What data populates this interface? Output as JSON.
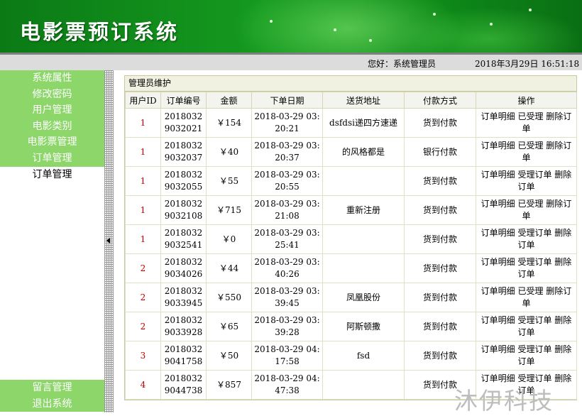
{
  "header": {
    "title": "电影票预订系统"
  },
  "infobar": {
    "greeting": "您好：系统管理员",
    "datetime": "2018年3月29日 16:51:18"
  },
  "sidebar": {
    "items": [
      "系统属性",
      "修改密码",
      "用户管理",
      "电影类别",
      "电影票管理",
      "订单管理"
    ],
    "active_sub": "订单管理",
    "bottom_items": [
      "留言管理",
      "退出系统"
    ]
  },
  "panel": {
    "title": "管理员维护"
  },
  "table": {
    "headers": [
      "用户ID",
      "订单编号",
      "金额",
      "下单日期",
      "送货地址",
      "付款方式",
      "操作"
    ],
    "rows": [
      {
        "uid": "1",
        "order": "20180329032021",
        "amount": "￥154",
        "date": "2018-03-29 03:20:21",
        "address": "dsfdsi递四方速递",
        "pay": "货到付款",
        "ops": "订单明细 已受理 删除订单"
      },
      {
        "uid": "1",
        "order": "20180329032037",
        "amount": "￥40",
        "date": "2018-03-29 03:20:37",
        "address": "的风格都是",
        "pay": "银行付款",
        "ops": "订单明细 已受理 删除订单"
      },
      {
        "uid": "1",
        "order": "20180329032055",
        "amount": "￥55",
        "date": "2018-03-29 03:20:55",
        "address": "",
        "pay": "货到付款",
        "ops": "订单明细 受理订单 删除订单"
      },
      {
        "uid": "1",
        "order": "20180329032108",
        "amount": "￥715",
        "date": "2018-03-29 03:21:08",
        "address": "重新注册",
        "pay": "货到付款",
        "ops": "订单明细 已受理 删除订单"
      },
      {
        "uid": "1",
        "order": "20180329032541",
        "amount": "￥0",
        "date": "2018-03-29 03:25:41",
        "address": "",
        "pay": "货到付款",
        "ops": "订单明细 受理订单 删除订单"
      },
      {
        "uid": "2",
        "order": "20180329034026",
        "amount": "￥44",
        "date": "2018-03-29 03:40:26",
        "address": "",
        "pay": "货到付款",
        "ops": "订单明细 受理订单 删除订单"
      },
      {
        "uid": "2",
        "order": "20180329033945",
        "amount": "￥550",
        "date": "2018-03-29 03:39:45",
        "address": "凤凰股份",
        "pay": "货到付款",
        "ops": "订单明细 已受理 删除订单"
      },
      {
        "uid": "2",
        "order": "20180329033928",
        "amount": "￥65",
        "date": "2018-03-29 03:39:28",
        "address": "阿斯顿撒",
        "pay": "货到付款",
        "ops": "订单明细 受理订单 删除订单"
      },
      {
        "uid": "3",
        "order": "20180329041758",
        "amount": "￥50",
        "date": "2018-03-29 04:17:58",
        "address": "fsd",
        "pay": "货到付款",
        "ops": "订单明细 受理订单 删除订单"
      },
      {
        "uid": "4",
        "order": "20180329044738",
        "amount": "￥857",
        "date": "2018-03-29 04:47:38",
        "address": "",
        "pay": "货到付款",
        "ops": "订单明细 受理订单 删除订单"
      }
    ]
  },
  "watermark": "沐伊科技"
}
